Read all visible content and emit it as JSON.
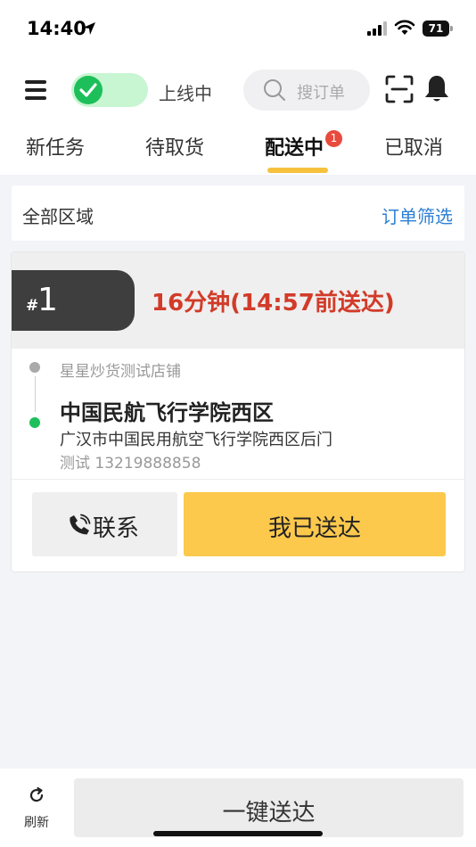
{
  "status_bar": {
    "time": "14:40",
    "battery": "71"
  },
  "header": {
    "online_label": "上线中",
    "search_placeholder": "搜订单"
  },
  "tabs": [
    {
      "label": "新任务"
    },
    {
      "label": "待取货"
    },
    {
      "label": "配送中",
      "badge": "1"
    },
    {
      "label": "已取消"
    }
  ],
  "region_bar": {
    "region": "全部区域",
    "filter": "订单筛选"
  },
  "order": {
    "hash": "#",
    "number": "1",
    "deadline": "16分钟(14:57前送达)",
    "shop_name": "星星炒货测试店铺",
    "drop_name": "中国民航飞行学院西区",
    "drop_address": "广汉市中国民用航空飞行学院西区后门",
    "customer": "测试 13219888858",
    "contact_label": "联系",
    "deliver_label": "我已送达"
  },
  "bottom_bar": {
    "refresh_label": "刷新",
    "batch_label": "一键送达"
  },
  "colors": {
    "accent_yellow": "#fcc94d",
    "online_green": "#1dbf5a",
    "deadline_red": "#d23b29",
    "link_blue": "#2d7fd3",
    "badge_red": "#e84a3d"
  }
}
